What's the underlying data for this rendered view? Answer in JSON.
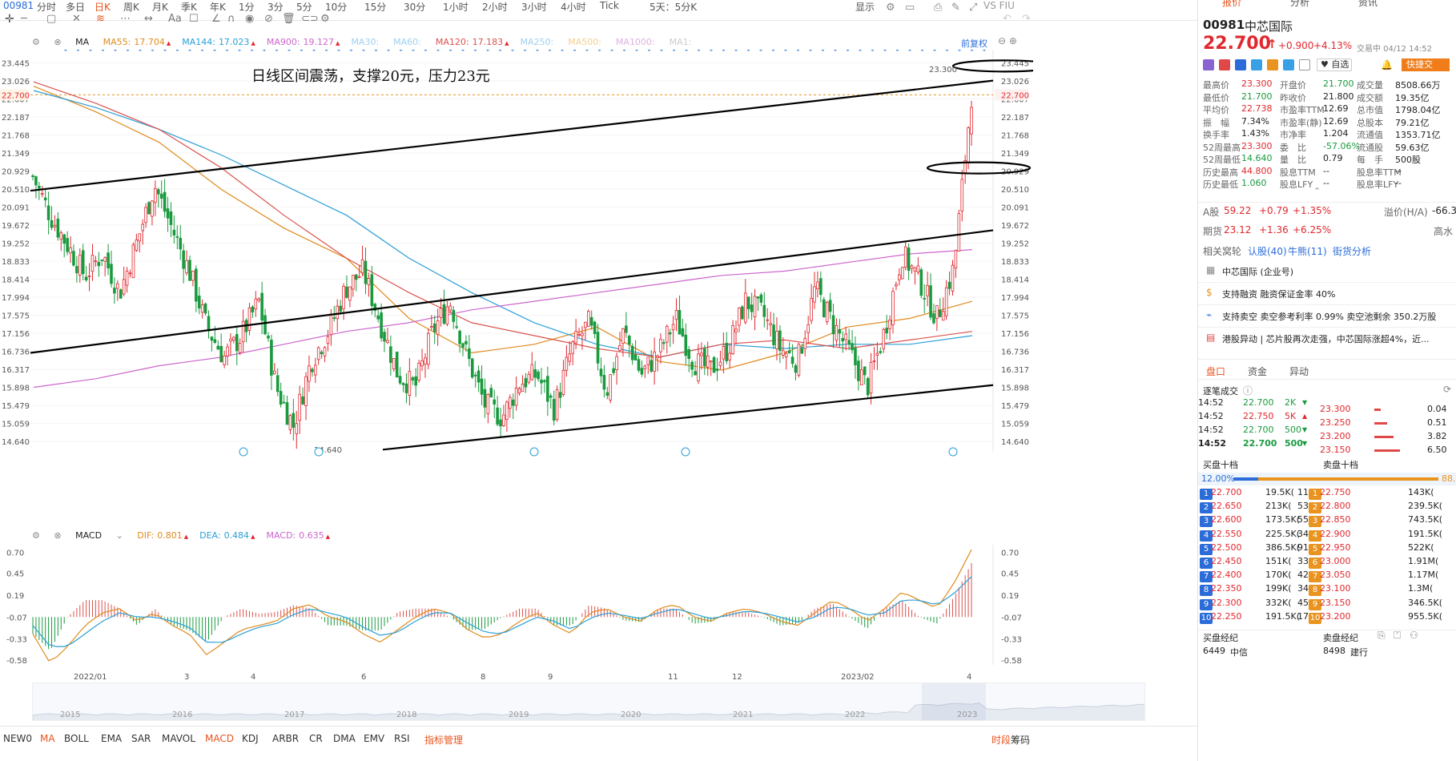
{
  "toolbar": {
    "code": "00981",
    "periods": [
      "分时",
      "多日",
      "日K",
      "周K",
      "月K",
      "季K",
      "年K",
      "1分",
      "3分",
      "5分",
      "10分",
      "15分",
      "30分",
      "1小时",
      "2小时",
      "3小时",
      "4小时",
      "Tick",
      "5天：5分K"
    ],
    "active_period": "日K",
    "display_label": "显示",
    "vs_label": "VS FIU"
  },
  "ma_legend": {
    "type": "MA",
    "items": [
      {
        "name": "MA55",
        "value": "17.704",
        "color": "#e08a1e"
      },
      {
        "name": "MA144",
        "value": "17.023",
        "color": "#2b9fd6"
      },
      {
        "name": "MA900",
        "value": "19.127",
        "color": "#cc66cc"
      },
      {
        "name": "MA30",
        "value": "",
        "color": "#9ecff0"
      },
      {
        "name": "MA60",
        "value": "",
        "color": "#9ecff0"
      },
      {
        "name": "MA120",
        "value": "17.183",
        "color": "#d9534f"
      },
      {
        "name": "MA250",
        "value": "",
        "color": "#9ecff0"
      },
      {
        "name": "MA500",
        "value": "",
        "color": "#f0d090"
      },
      {
        "name": "MA1000",
        "value": "",
        "color": "#e0b0e0"
      },
      {
        "name": "MA1",
        "value": "",
        "color": "#ccc"
      }
    ],
    "restore_label": "前复权"
  },
  "chart_data": [
    {
      "type": "candlestick",
      "title": "",
      "annotation": "日线区间震荡，支撑20元，压力23元",
      "y_ticks": [
        "23.445",
        "23.026",
        "22.607",
        "22.187",
        "21.768",
        "21.349",
        "20.929",
        "20.510",
        "20.091",
        "19.672",
        "19.252",
        "18.833",
        "18.414",
        "17.994",
        "17.575",
        "17.156",
        "16.736",
        "16.317",
        "15.898",
        "15.479",
        "15.059",
        "14.640"
      ],
      "ylim": [
        14.4,
        23.6
      ],
      "current_price_tag": "22.700",
      "high_mark": "23.300",
      "low_mark": "14.640",
      "x_ticks": [
        "2022/01",
        "3",
        "4",
        "6",
        "8",
        "9",
        "11",
        "12",
        "2023/02",
        "4"
      ],
      "series": [
        {
          "name": "MA55",
          "color": "#e08a1e",
          "values": [
            22.9,
            22.3,
            21.6,
            20.5,
            19.6,
            18.9,
            17.5,
            16.7,
            16.9,
            17.3,
            16.5,
            16.3,
            16.7,
            17.3,
            17.5,
            17.9
          ]
        },
        {
          "name": "MA144",
          "color": "#2b9fd6",
          "values": [
            22.8,
            22.4,
            21.9,
            21.3,
            20.6,
            19.9,
            18.9,
            18.1,
            17.4,
            16.9,
            16.6,
            16.9,
            16.8,
            16.9,
            16.9,
            17.1
          ]
        },
        {
          "name": "MA120",
          "color": "#d9534f",
          "values": [
            23.0,
            22.5,
            21.9,
            21.0,
            19.9,
            18.9,
            18.1,
            17.4,
            17.1,
            16.8,
            16.6,
            16.9,
            17.0,
            16.8,
            17.0,
            17.2
          ]
        },
        {
          "name": "MA900",
          "color": "#cc66cc",
          "values": [
            15.9,
            16.1,
            16.4,
            16.6,
            16.9,
            17.2,
            17.4,
            17.7,
            17.9,
            18.1,
            18.3,
            18.5,
            18.6,
            18.8,
            19.0,
            19.1
          ]
        }
      ],
      "close_path": [
        20.8,
        19.9,
        19.2,
        18.5,
        19.0,
        18.1,
        19.3,
        20.6,
        19.6,
        18.6,
        17.3,
        16.6,
        17.1,
        17.9,
        15.9,
        15.0,
        16.5,
        17.2,
        18.2,
        18.6,
        17.4,
        16.2,
        15.9,
        17.2,
        17.9,
        16.6,
        15.5,
        15.2,
        16.0,
        16.2,
        15.4,
        16.8,
        17.4,
        15.8,
        17.2,
        16.2,
        16.7,
        17.5,
        16.5,
        16.3,
        16.8,
        17.9,
        17.6,
        16.8,
        16.5,
        18.2,
        17.4,
        16.7,
        15.9,
        17.2,
        19.0,
        18.4,
        17.5,
        18.7,
        22.7
      ]
    },
    {
      "type": "bar",
      "title": "MACD",
      "legend": [
        {
          "name": "DIF",
          "value": "0.801",
          "color": "#e08a1e"
        },
        {
          "name": "DEA",
          "value": "0.484",
          "color": "#2b9fd6"
        },
        {
          "name": "MACD",
          "value": "0.635",
          "color": "#cc66cc"
        }
      ],
      "y_ticks": [
        "0.70",
        "0.45",
        "0.19",
        "-0.07",
        "-0.33",
        "-0.58"
      ],
      "ylim": [
        -0.6,
        0.75
      ],
      "dif": [
        -0.2,
        -0.55,
        -0.35,
        -0.1,
        0.05,
        0.1,
        -0.05,
        0.05,
        -0.1,
        -0.2,
        -0.45,
        -0.3,
        -0.15,
        -0.1,
        -0.05,
        0.1,
        0.15,
        0.0,
        -0.05,
        -0.2,
        -0.3,
        -0.15,
        0.0,
        0.1,
        0.05,
        -0.15,
        -0.25,
        -0.2,
        -0.05,
        0.05,
        -0.1,
        -0.2,
        0.05,
        0.1,
        0.0,
        -0.05,
        0.1,
        0.15,
        0.0,
        -0.05,
        0.05,
        0.1,
        0.05,
        -0.05,
        -0.1,
        0.05,
        0.2,
        0.1,
        -0.05,
        0.1,
        0.3,
        0.2,
        0.1,
        0.4,
        0.8
      ],
      "dea": [
        -0.1,
        -0.35,
        -0.35,
        -0.2,
        -0.05,
        0.05,
        0.0,
        0.0,
        -0.05,
        -0.12,
        -0.3,
        -0.3,
        -0.2,
        -0.12,
        -0.08,
        0.03,
        0.1,
        0.05,
        0.0,
        -0.12,
        -0.22,
        -0.18,
        -0.05,
        0.05,
        0.05,
        -0.07,
        -0.18,
        -0.2,
        -0.1,
        0.0,
        -0.05,
        -0.15,
        -0.02,
        0.05,
        0.02,
        -0.02,
        0.05,
        0.1,
        0.04,
        -0.02,
        0.02,
        0.07,
        0.05,
        0.0,
        -0.06,
        0.0,
        0.12,
        0.1,
        0.02,
        0.05,
        0.2,
        0.2,
        0.14,
        0.28,
        0.48
      ]
    }
  ],
  "navigator_years": [
    "2015",
    "2016",
    "2017",
    "2018",
    "2019",
    "2020",
    "2021",
    "2022",
    "2023"
  ],
  "indicator_tabs": [
    "NEW0",
    "MA",
    "BOLL",
    "EMA",
    "SAR",
    "MAVOL",
    "MACD",
    "KDJ",
    "ARBR",
    "CR",
    "DMA",
    "EMV",
    "RSI",
    "指标管理"
  ],
  "indicator_active": [
    "MA",
    "MACD"
  ],
  "bottom_right": {
    "time_share": "时段",
    "chip": "筹码"
  },
  "quote": {
    "tabs": [
      "报价",
      "分析",
      "资讯"
    ],
    "code": "00981",
    "name": "中芯国际",
    "price": "22.700",
    "change": "+0.900",
    "change_pct": "+4.13%",
    "time": "交易中 04/12 14:52",
    "watch_label": "自选",
    "fast_label": "快捷交",
    "stats_left": [
      [
        "最高价",
        "23.300",
        "red"
      ],
      [
        "最低价",
        "21.700",
        "green"
      ],
      [
        "平均价",
        "22.738",
        "red"
      ],
      [
        "振　幅",
        "7.34%",
        "dark"
      ],
      [
        "换手率",
        "1.43%",
        "dark"
      ],
      [
        "52周最高",
        "23.300",
        "red"
      ],
      [
        "52周最低",
        "14.640",
        "green"
      ],
      [
        "历史最高",
        "44.800",
        "red"
      ],
      [
        "历史最低",
        "1.060",
        "green"
      ]
    ],
    "stats_mid": [
      [
        "开盘价",
        "21.700",
        "green"
      ],
      [
        "昨收价",
        "21.800",
        "dark"
      ],
      [
        "市盈率TTM",
        "12.69",
        "dark"
      ],
      [
        "市盈率(静)",
        "12.69",
        "dark"
      ],
      [
        "市净率",
        "1.204",
        "dark"
      ],
      [
        "委　比",
        "-57.06%",
        "green"
      ],
      [
        "量　比",
        "0.79",
        "dark"
      ],
      [
        "股息TTM",
        "--",
        "dark"
      ],
      [
        "股息LFY",
        "--",
        "dark"
      ]
    ],
    "stats_right": [
      [
        "成交量",
        "8508.66万",
        "dark"
      ],
      [
        "成交额",
        "19.35亿",
        "dark"
      ],
      [
        "总市值",
        "1798.04亿",
        "dark"
      ],
      [
        "总股本",
        "79.21亿",
        "dark"
      ],
      [
        "流通值",
        "1353.71亿",
        "dark"
      ],
      [
        "流通股",
        "59.63亿",
        "dark"
      ],
      [
        "每　手",
        "500股",
        "dark"
      ],
      [
        "股息率TTM",
        "--",
        "dark"
      ],
      [
        "股息率LFY",
        "--",
        "dark"
      ]
    ],
    "a_share": {
      "label": "A股",
      "price": "59.22",
      "change": "+0.79",
      "pct": "+1.35%",
      "premium_label": "溢价(H/A)",
      "premium": "-66.3"
    },
    "futures": {
      "label": "期货",
      "price": "23.12",
      "change": "+1.36",
      "pct": "+6.25%",
      "high_low": "高水"
    },
    "warrants": {
      "label": "相关窝轮",
      "call": "认股(40)",
      "bull": "牛熊(11)",
      "street": "街货分析"
    },
    "info": [
      {
        "icon": "building-icon",
        "text": "中芯国际 (企业号)"
      },
      {
        "icon": "coin-icon",
        "text": "支持融资  融资保证金率 40%"
      },
      {
        "icon": "chart-icon",
        "text": "支持卖空  卖空参考利率 0.99%  卖空池剩余 350.2万股"
      },
      {
        "icon": "news-icon",
        "text": "港股异动 | 芯片股再次走强，中芯国际涨超4%，近..."
      }
    ],
    "sub_tabs": [
      "盘口",
      "资金",
      "异动"
    ],
    "ticks_title": "逐笔成交",
    "ticks": [
      [
        "14:52",
        "22.700",
        "2K",
        "green"
      ],
      [
        "14:52",
        "22.750",
        "5K",
        "red"
      ],
      [
        "14:52",
        "22.700",
        "500",
        "green"
      ],
      [
        "14:52",
        "22.700",
        "500",
        "green"
      ]
    ],
    "ask_side": [
      [
        "23.300",
        "0.04"
      ],
      [
        "23.250",
        "0.51"
      ],
      [
        "23.200",
        "3.82"
      ],
      [
        "23.150",
        "6.50"
      ]
    ],
    "book_left_title": "买盘十档",
    "book_right_title": "卖盘十档",
    "buy_pct": "12.00%",
    "sell_pct": "88.",
    "buy_ratio": 0.12,
    "book": [
      [
        "22.700",
        "19.5K(",
        "11)",
        "22.750",
        "143K("
      ],
      [
        "22.650",
        "213K(",
        "53)",
        "22.800",
        "239.5K("
      ],
      [
        "22.600",
        "173.5K(",
        "55)",
        "22.850",
        "743.5K("
      ],
      [
        "22.550",
        "225.5K(",
        "34)",
        "22.900",
        "191.5K("
      ],
      [
        "22.500",
        "386.5K(",
        "91)",
        "22.950",
        "522K("
      ],
      [
        "22.450",
        "151K(",
        "33)",
        "23.000",
        "1.91M("
      ],
      [
        "22.400",
        "170K(",
        "42)",
        "23.050",
        "1.17M("
      ],
      [
        "22.350",
        "199K(",
        "34)",
        "23.100",
        "1.3M("
      ],
      [
        "22.300",
        "332K(",
        "45)",
        "23.150",
        "346.5K("
      ],
      [
        "22.250",
        "191.5K(",
        "17)",
        "23.200",
        "955.5K("
      ]
    ],
    "broker_left": "买盘经纪",
    "broker_right": "卖盘经纪",
    "broker_rows": [
      [
        "6449",
        "中信",
        "8498",
        "建行"
      ]
    ]
  }
}
